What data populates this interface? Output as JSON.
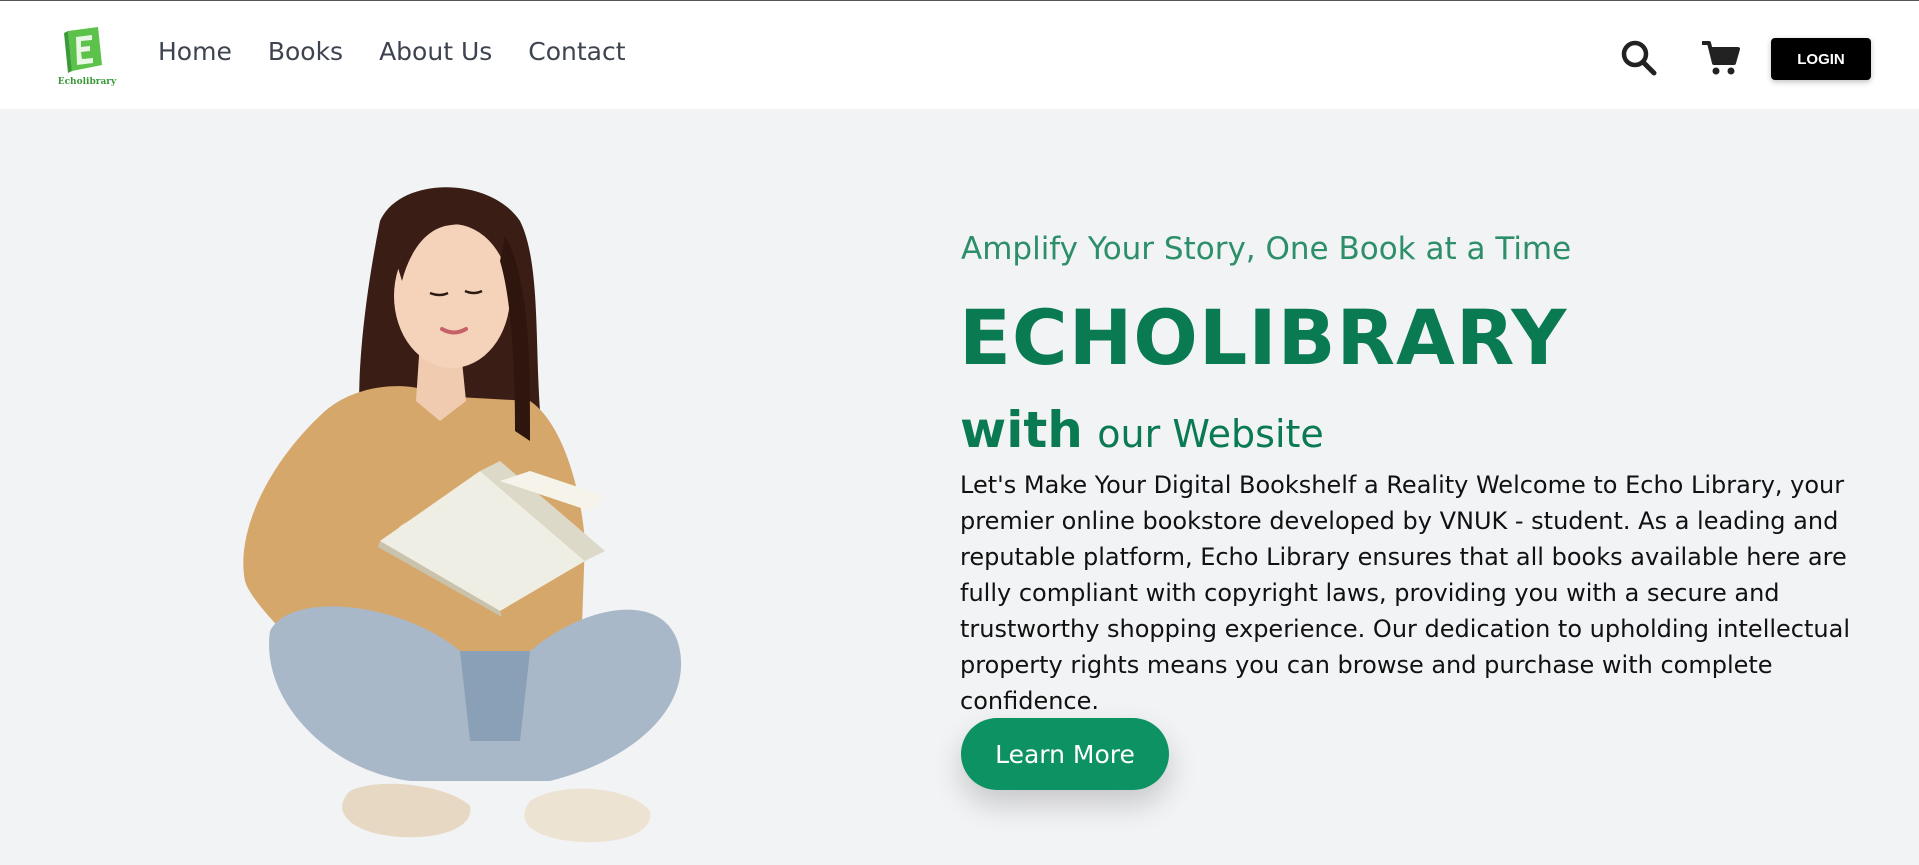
{
  "header": {
    "logo_text": "Echolibrary",
    "nav": [
      "Home",
      "Books",
      "About Us",
      "Contact"
    ],
    "login_label": "LOGIN"
  },
  "hero": {
    "tagline": "Amplify Your Story, One Book at a Time",
    "brand": "ECHOLIBRARY",
    "with_bold": "with",
    "with_light": "our Website",
    "description": "Let's Make Your Digital Bookshelf a Reality Welcome to Echo Library, your premier online bookstore developed by VNUK - student. As a leading and reputable platform, Echo Library ensures that all books available here are fully compliant with copyright laws, providing you with a secure and trustworthy shopping experience. Our dedication to upholding intellectual property rights means you can browse and purchase with complete confidence.",
    "cta_label": "Learn More"
  },
  "icons": {
    "search": "search-icon",
    "cart": "cart-icon",
    "logo": "book-logo-icon"
  },
  "colors": {
    "brand_green": "#0a7a52",
    "button_green": "#0d9263",
    "tagline_green": "#2c8f6a",
    "background": "#f2f3f5"
  }
}
